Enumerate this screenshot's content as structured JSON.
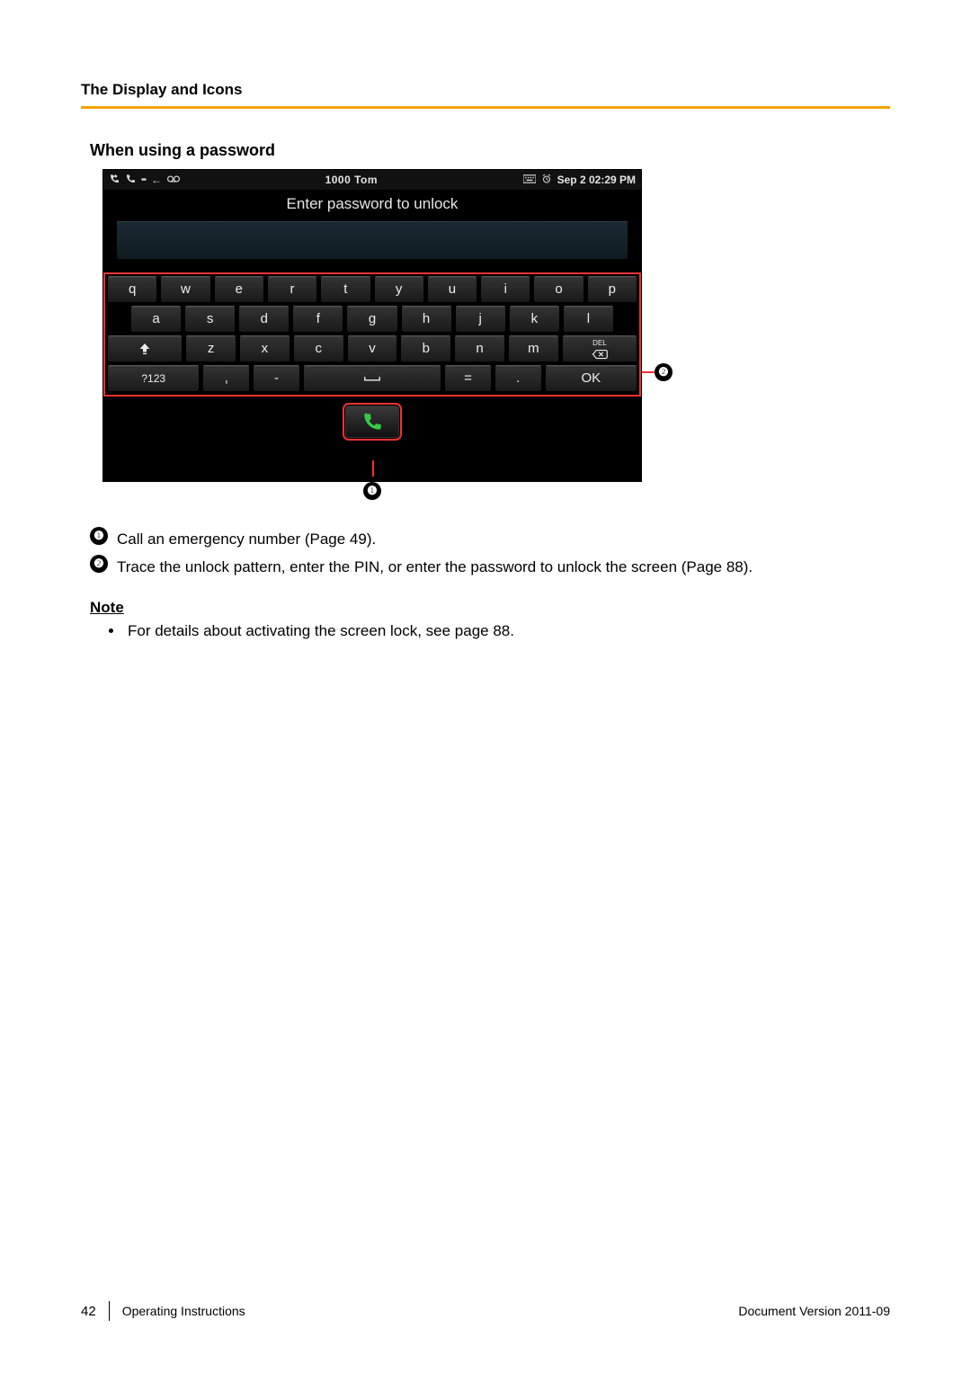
{
  "section_header": "The Display and Icons",
  "subheading": "When using a password",
  "status": {
    "ext_label": "1000  Tom",
    "datetime": "Sep 2 02:29 PM",
    "left_icons": [
      "phone-forward-icon",
      "handset-icon",
      "dots-icon",
      "arrow-left-icon",
      "voicemail-icon"
    ],
    "right_icons": [
      "keyboard-icon",
      "alarm-icon"
    ]
  },
  "prompt": "Enter password to unlock",
  "password_value": "",
  "keyboard": {
    "row1": [
      "q",
      "w",
      "e",
      "r",
      "t",
      "y",
      "u",
      "i",
      "o",
      "p"
    ],
    "row2": [
      "a",
      "s",
      "d",
      "f",
      "g",
      "h",
      "j",
      "k",
      "l"
    ],
    "row3_shift": "⇧",
    "row3": [
      "z",
      "x",
      "c",
      "v",
      "b",
      "n",
      "m"
    ],
    "row3_del_top": "DEL",
    "row4_sym": "?123",
    "row4_comma": ",",
    "row4_dash": "-",
    "row4_space": "␣",
    "row4_eq": "=",
    "row4_dot": ".",
    "row4_ok": "OK"
  },
  "legend": {
    "n1": "Call an emergency number (Page 49).",
    "n2": "Trace the unlock pattern, enter the PIN, or enter the password to unlock the screen (Page 88)."
  },
  "note_heading": "Note",
  "notes": [
    "For details about activating the screen lock, see page 88."
  ],
  "footer": {
    "page": "42",
    "title": "Operating Instructions",
    "doc_version_label": "Document Version  2011-09"
  }
}
